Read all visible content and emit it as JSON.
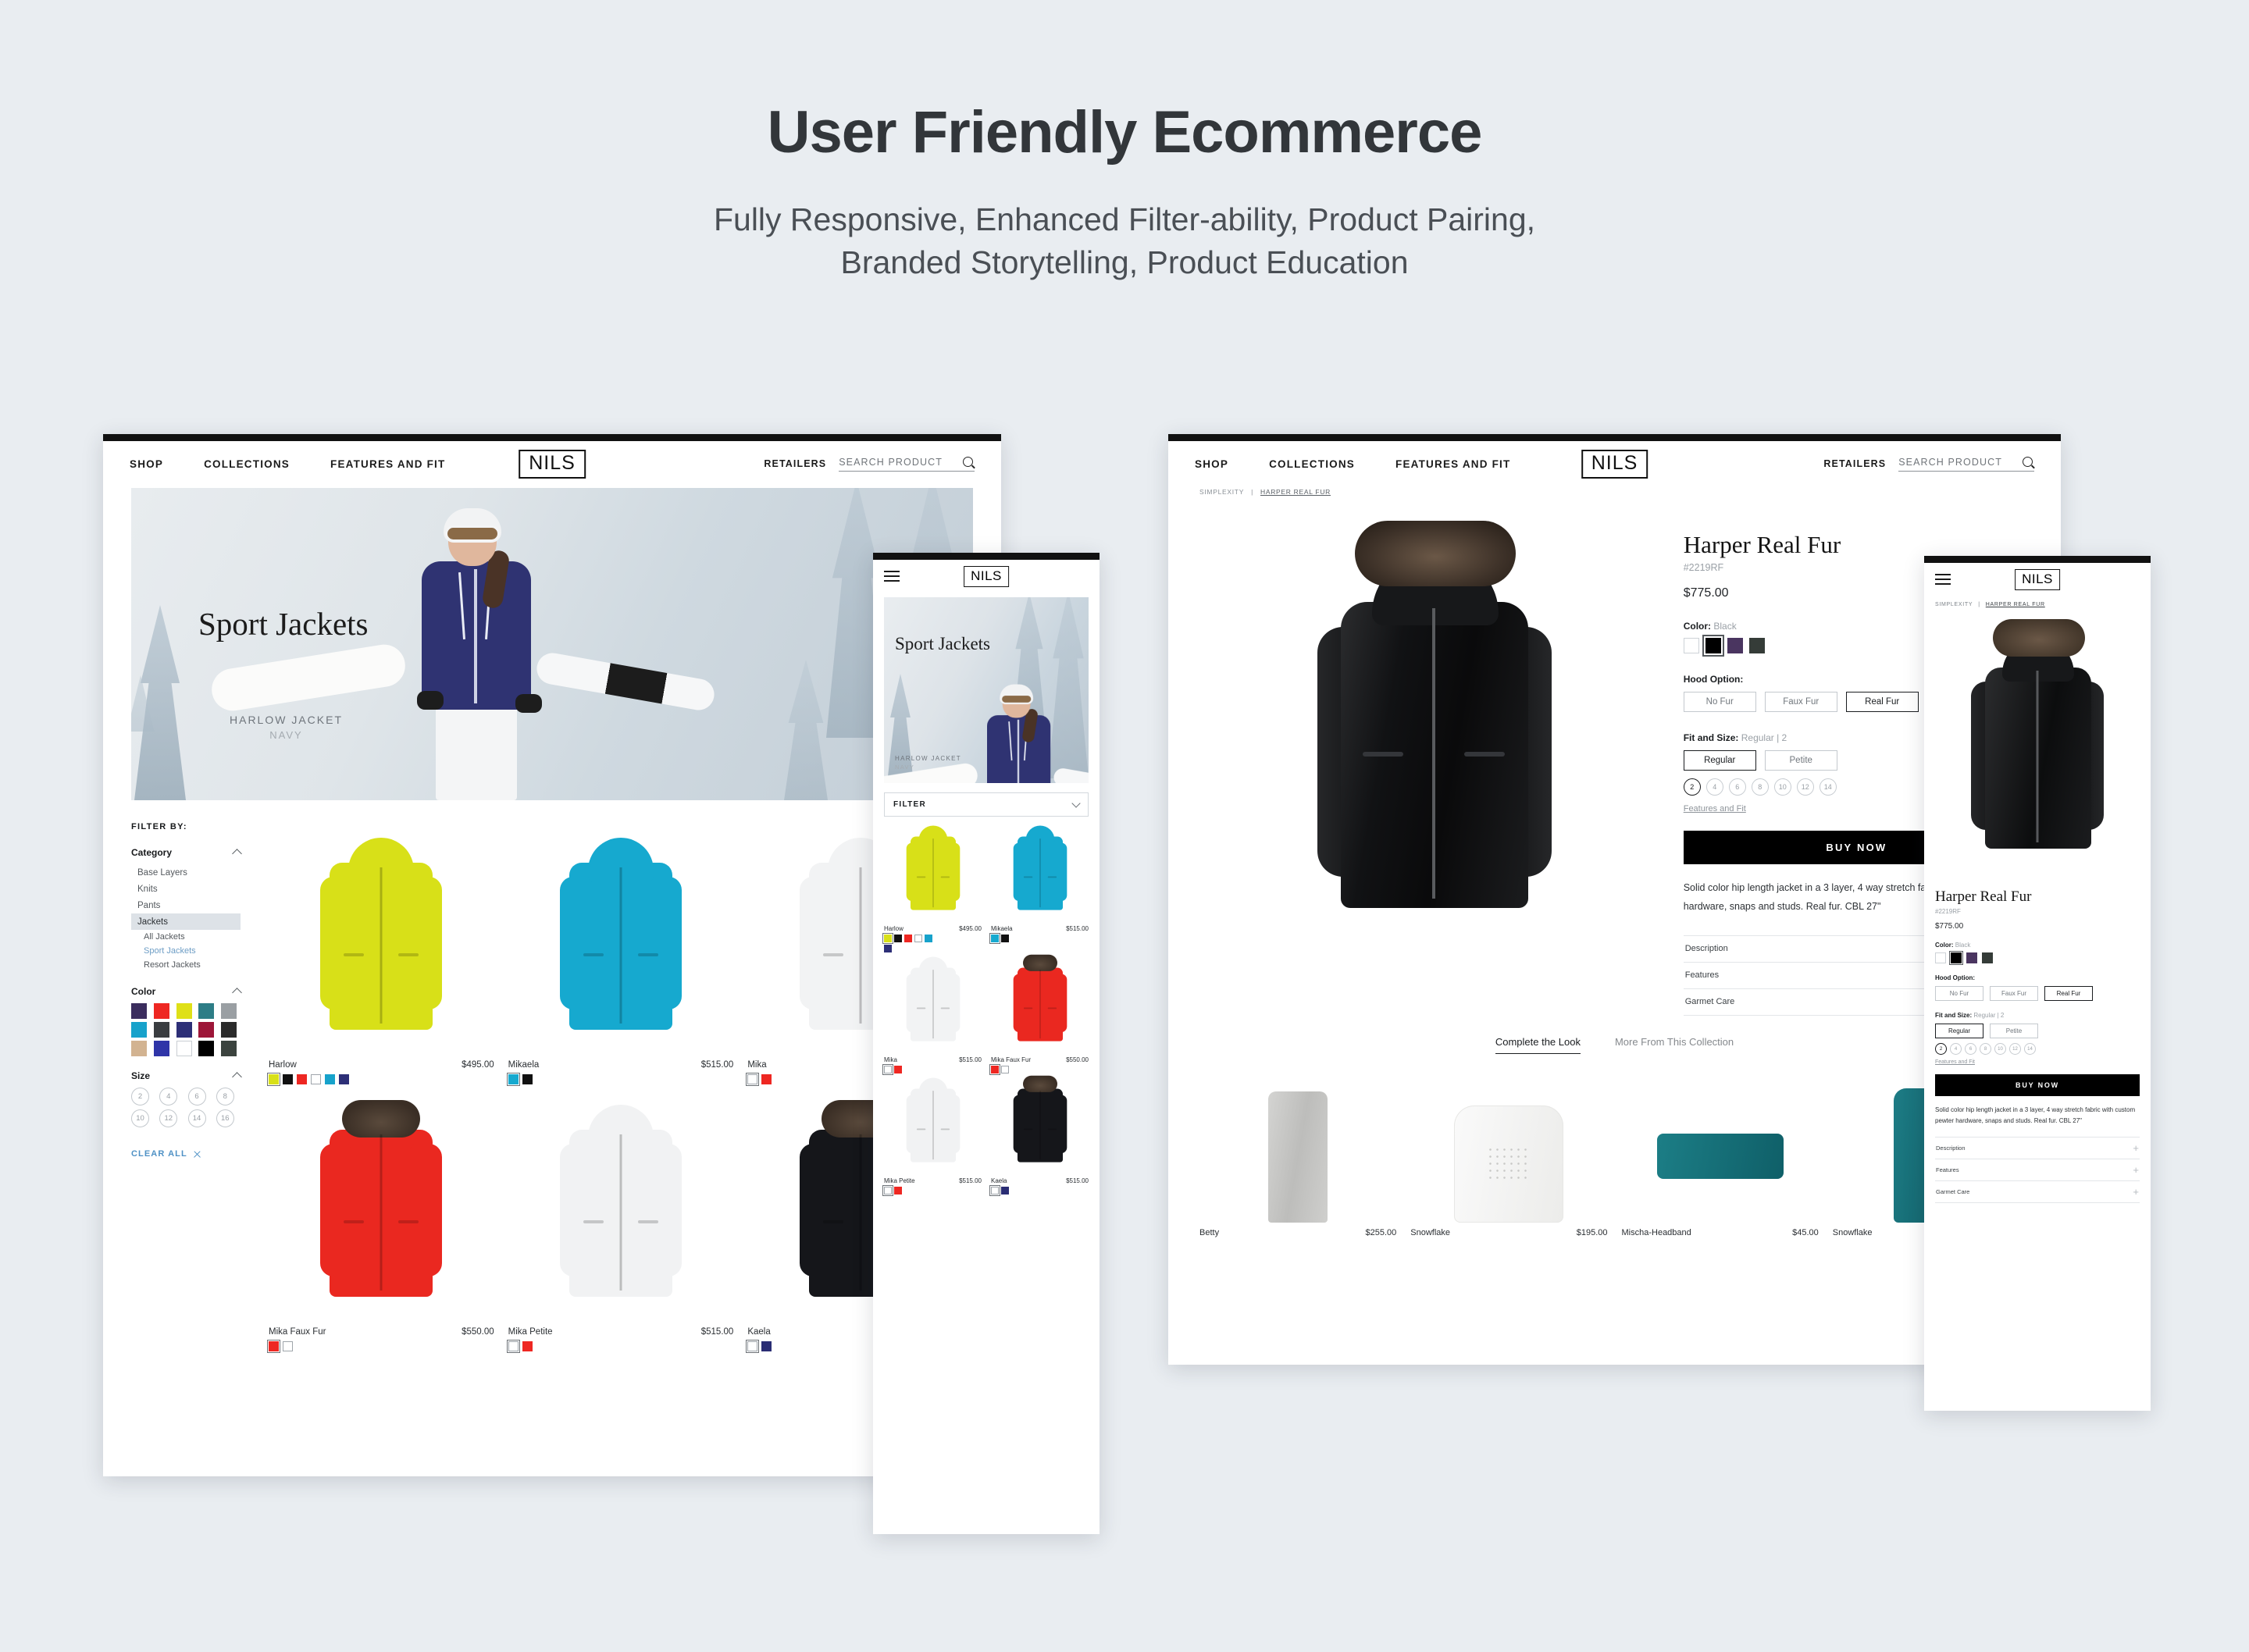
{
  "hero": {
    "title": "User Friendly Ecommerce",
    "subtitle_line1": "Fully Responsive, Enhanced Filter-ability, Product Pairing,",
    "subtitle_line2": "Branded Storytelling, Product Education"
  },
  "brand": {
    "logo": "NILS"
  },
  "nav": {
    "links": [
      "SHOP",
      "COLLECTIONS",
      "FEATURES AND FIT"
    ],
    "retailers": "RETAILERS",
    "search_placeholder": "SEARCH PRODUCT",
    "search_icon": "search-icon"
  },
  "plp": {
    "banner": {
      "title": "Sport Jackets",
      "caption_product": "HARLOW JACKET",
      "caption_color": "NAVY"
    },
    "filter_heading": "FILTER BY:",
    "groups": [
      {
        "name": "Category",
        "items": [
          "Base Layers",
          "Knits",
          "Pants",
          "Jackets"
        ],
        "selected": "Jackets",
        "sub_items": [
          "All Jackets",
          "Sport Jackets",
          "Resort Jackets"
        ],
        "sub_active": "Sport Jackets"
      },
      {
        "name": "Color"
      },
      {
        "name": "Size"
      }
    ],
    "color_swatches": [
      "#3b2d5e",
      "#ee2722",
      "#dfe017",
      "#2d7d86",
      "#9a9fa3",
      "#17a2cb",
      "#3a3d40",
      "#2d2f77",
      "#9d1638",
      "#2b2b2b",
      "#d2b391",
      "#2f35a8",
      "#ffffff",
      "#000000",
      "#3b433e"
    ],
    "sizes": [
      "2",
      "4",
      "6",
      "8",
      "10",
      "12",
      "14",
      "16"
    ],
    "clear_all": "CLEAR ALL",
    "products": [
      {
        "name": "Harlow",
        "price": "$495.00",
        "jacket_color": "#d8e018",
        "swatches": [
          "#d8e018",
          "#111111",
          "#ee2722",
          "#ffffff",
          "#17a2cb",
          "#2d2f77"
        ],
        "selected_index": 0
      },
      {
        "name": "Mikaela",
        "price": "$515.00",
        "jacket_color": "#16a9cf",
        "swatches": [
          "#16a9cf",
          "#111111"
        ],
        "selected_index": 0
      },
      {
        "name": "Mika",
        "price": "$515.00",
        "jacket_color": "#f2f3f4",
        "swatches": [
          "#ffffff",
          "#ee2722"
        ],
        "selected_index": 0
      },
      {
        "name": "Mika Faux Fur",
        "price": "$550.00",
        "jacket_color": "#ea2820",
        "swatches": [
          "#ee2722",
          "#ffffff"
        ],
        "selected_index": 0
      },
      {
        "name": "Mika Petite",
        "price": "$515.00",
        "jacket_color": "#f1f2f3",
        "swatches": [
          "#ffffff",
          "#ee2722"
        ],
        "selected_index": 0
      },
      {
        "name": "Kaela",
        "price": "$515.00",
        "jacket_color": "#15161a",
        "swatches": [
          "#ffffff",
          "#2a2d74"
        ],
        "selected_index": 0
      }
    ]
  },
  "pdp": {
    "breadcrumb": {
      "parent": "SIMPLEXITY",
      "separator": "|",
      "current": "HARPER REAL FUR"
    },
    "title": "Harper Real Fur",
    "sku": "#2219RF",
    "price": "$775.00",
    "color_label": "Color:",
    "color_value": "Black",
    "color_swatches": [
      "#ffffff",
      "#000000",
      "#4a3560",
      "#353c38"
    ],
    "color_selected_index": 1,
    "hood_label": "Hood Option:",
    "hood_options": [
      "No Fur",
      "Faux Fur",
      "Real Fur"
    ],
    "hood_selected": "Real Fur",
    "fit_label": "Fit and Size:",
    "fit_value": "Regular | 2",
    "fit_options": [
      "Regular",
      "Petite"
    ],
    "fit_selected": "Regular",
    "sizes": [
      "2",
      "4",
      "6",
      "8",
      "10",
      "12",
      "14"
    ],
    "size_selected": "2",
    "features_link": "Features and Fit",
    "buy_label": "BUY NOW",
    "description": "Solid color hip length jacket in a 3 layer, 4 way stretch fabric with custom pewter hardware, snaps and studs. Real fur. CBL 27\"",
    "accordions": [
      "Description",
      "Features",
      "Garmet Care"
    ],
    "accordion_icon": "+",
    "tabs": [
      {
        "label": "Complete the Look",
        "active": true
      },
      {
        "label": "More From This Collection",
        "active": false
      }
    ],
    "related": [
      {
        "name": "Betty",
        "price": "$255.00",
        "kind": "pants"
      },
      {
        "name": "Snowflake",
        "price": "$195.00",
        "kind": "sweater"
      },
      {
        "name": "Mischa-Headband",
        "price": "$45.00",
        "kind": "headband"
      },
      {
        "name": "Snowflake",
        "price": "",
        "kind": "baselayer"
      }
    ]
  },
  "mobile_plp": {
    "menu_icon": "hamburger-icon",
    "filter_label": "FILTER",
    "filter_caret": "chevron-down-icon",
    "products": [
      {
        "name": "Harlow",
        "price": "$495.00",
        "jacket_color": "#d8e018",
        "swatches": [
          "#d8e018",
          "#111111",
          "#ee2722",
          "#ffffff",
          "#17a2cb",
          "#2d2f77"
        ],
        "selected_index": 0
      },
      {
        "name": "Mikaela",
        "price": "$515.00",
        "jacket_color": "#16a9cf",
        "swatches": [
          "#16a9cf",
          "#111111"
        ],
        "selected_index": 0
      },
      {
        "name": "Mika",
        "price": "$515.00",
        "jacket_color": "#f2f3f4",
        "swatches": [
          "#ffffff",
          "#ee2722"
        ],
        "selected_index": 0
      },
      {
        "name": "Mika Faux Fur",
        "price": "$550.00",
        "jacket_color": "#ea2820",
        "swatches": [
          "#ee2722",
          "#ffffff"
        ],
        "selected_index": 0
      },
      {
        "name": "Mika Petite",
        "price": "$515.00",
        "jacket_color": "#f1f2f3",
        "swatches": [
          "#ffffff",
          "#ee2722"
        ],
        "selected_index": 0
      },
      {
        "name": "Kaela",
        "price": "$515.00",
        "jacket_color": "#15161a",
        "swatches": [
          "#ffffff",
          "#2a2d74"
        ],
        "selected_index": 0
      }
    ]
  }
}
